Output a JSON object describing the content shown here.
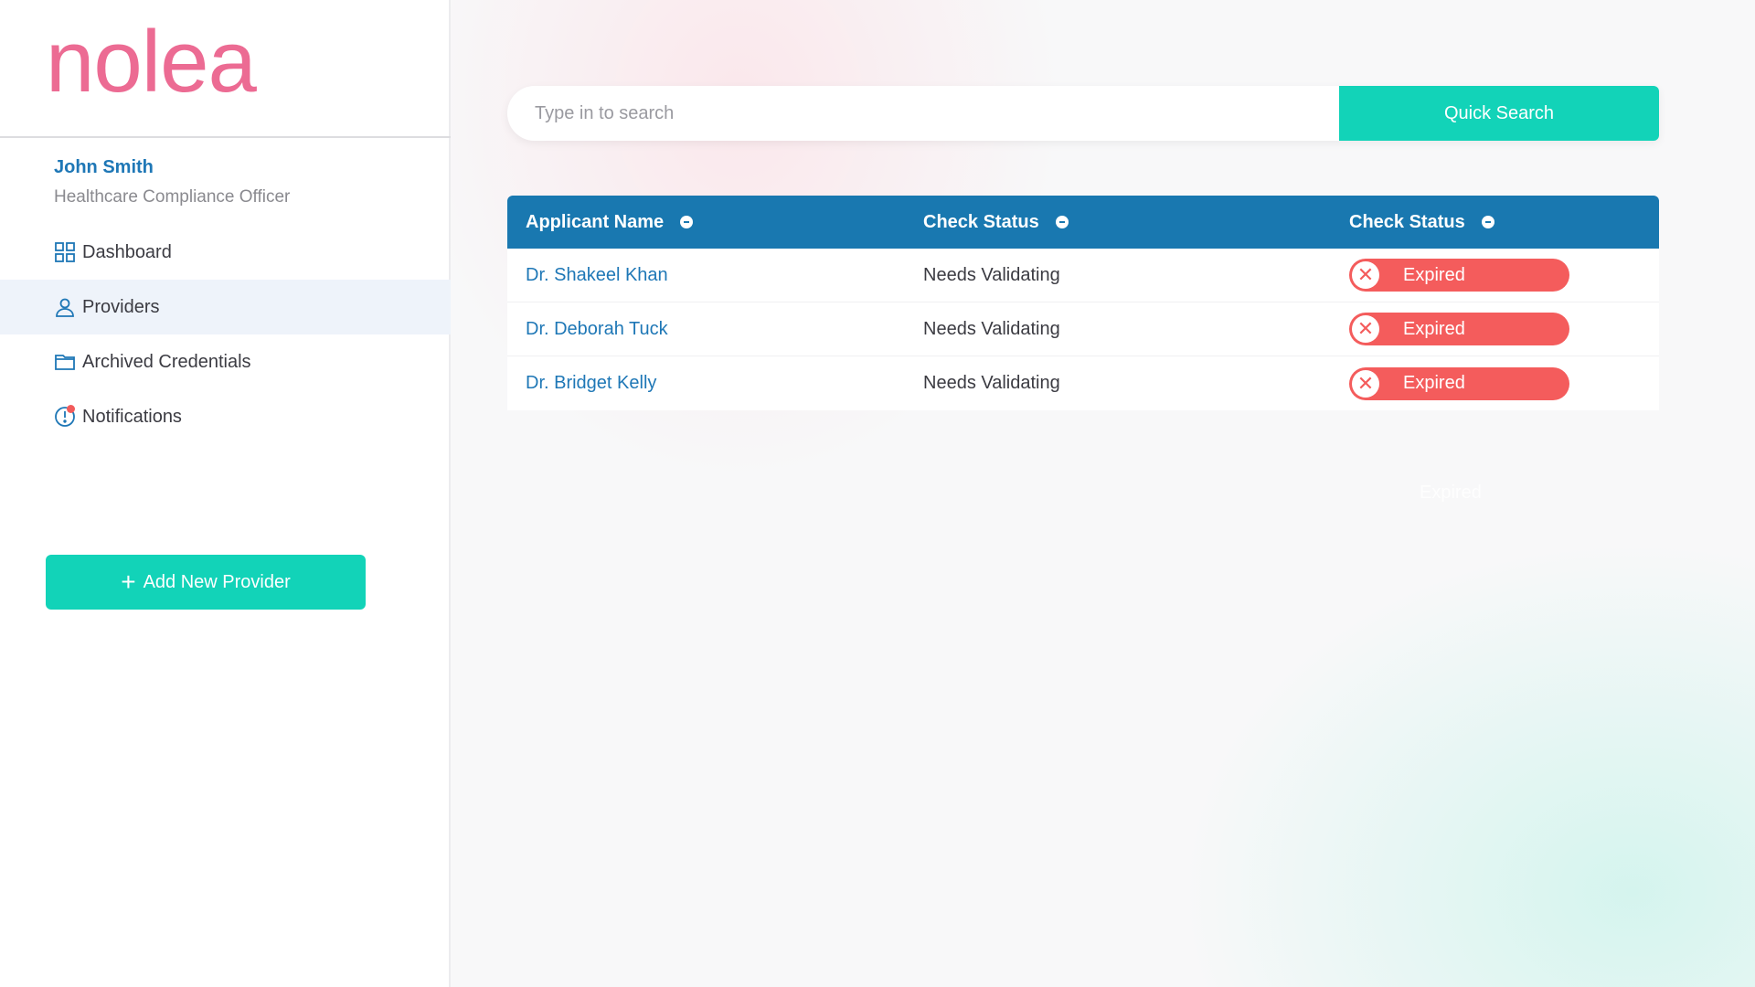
{
  "brand": {
    "logo_text": "nolea"
  },
  "user": {
    "name": "John Smith",
    "role": "Healthcare Compliance Officer"
  },
  "sidebar": {
    "items": [
      {
        "label": "Dashboard",
        "icon": "dashboard-grid-icon",
        "active": false
      },
      {
        "label": "Providers",
        "icon": "user-icon",
        "active": true
      },
      {
        "label": "Archived Credentials",
        "icon": "folder-icon",
        "active": false
      },
      {
        "label": "Notifications",
        "icon": "alert-clock-icon",
        "active": false,
        "has_badge": true
      }
    ],
    "add_button_label": "Add New Provider"
  },
  "search": {
    "placeholder": "Type in to search",
    "button_label": "Quick Search"
  },
  "table": {
    "headers": [
      "Applicant Name",
      "Check Status",
      "Check Status"
    ],
    "rows": [
      {
        "name": "Dr. Shakeel Khan",
        "status": "Needs Validating",
        "badge": "Expired"
      },
      {
        "name": "Dr. Deborah Tuck",
        "status": "Needs Validating",
        "badge": "Expired"
      },
      {
        "name": "Dr. Bridget Kelly",
        "status": "Needs Validating",
        "badge": "Expired"
      }
    ]
  },
  "ghost_label": "Expired",
  "colors": {
    "brand_pink": "#ec6b93",
    "primary_blue": "#1978b0",
    "accent_teal": "#12d3b8",
    "danger_red": "#f45c5c"
  }
}
